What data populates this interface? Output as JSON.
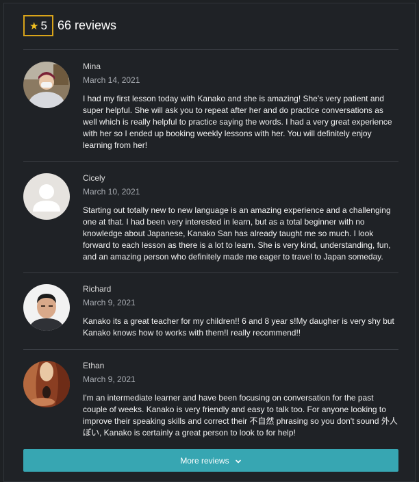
{
  "summary": {
    "rating": "5",
    "review_count": "66 reviews"
  },
  "reviews": [
    {
      "name": "Mina",
      "date": "March 14, 2021",
      "text": "I had my first lesson today with Kanako and she is amazing! She's very patient and super helpful. She will ask you to repeat after her and do practice conversations as well which is really helpful to practice saying the words. I had a very great experience with her so I ended up booking weekly lessons with her. You will definitely enjoy learning from her!"
    },
    {
      "name": "Cicely",
      "date": "March 10, 2021",
      "text": "Starting out totally new to new language is an amazing experience and a challenging one at that. I had been very interested in learn, but as a total beginner with no knowledge about Japanese, Kanako San has already taught me so much. I look forward to each lesson as there is a lot to learn. She is very kind, understanding, fun, and an amazing person who definitely made me eager to travel to Japan someday."
    },
    {
      "name": "Richard",
      "date": "March 9, 2021",
      "text": "Kanako its a great teacher for my children!! 6 and 8 year s!My daugher is very shy but Kanako knows how to works with them!I really recommend!!"
    },
    {
      "name": "Ethan",
      "date": "March 9, 2021",
      "text": "I'm an intermediate learner and have been focusing on conversation for the past couple of weeks. Kanako is very friendly and easy to talk too. For anyone looking to improve their speaking skills and correct their 不自然 phrasing so you don't sound 外人ぽい, Kanako is certainly a great person to look to for help!"
    }
  ],
  "more_button": {
    "label": "More reviews",
    "icon": "chevron-down-icon"
  },
  "colors": {
    "accent": "#37a6b2",
    "star": "#f2c021",
    "badge_border": "#d9a41a"
  }
}
